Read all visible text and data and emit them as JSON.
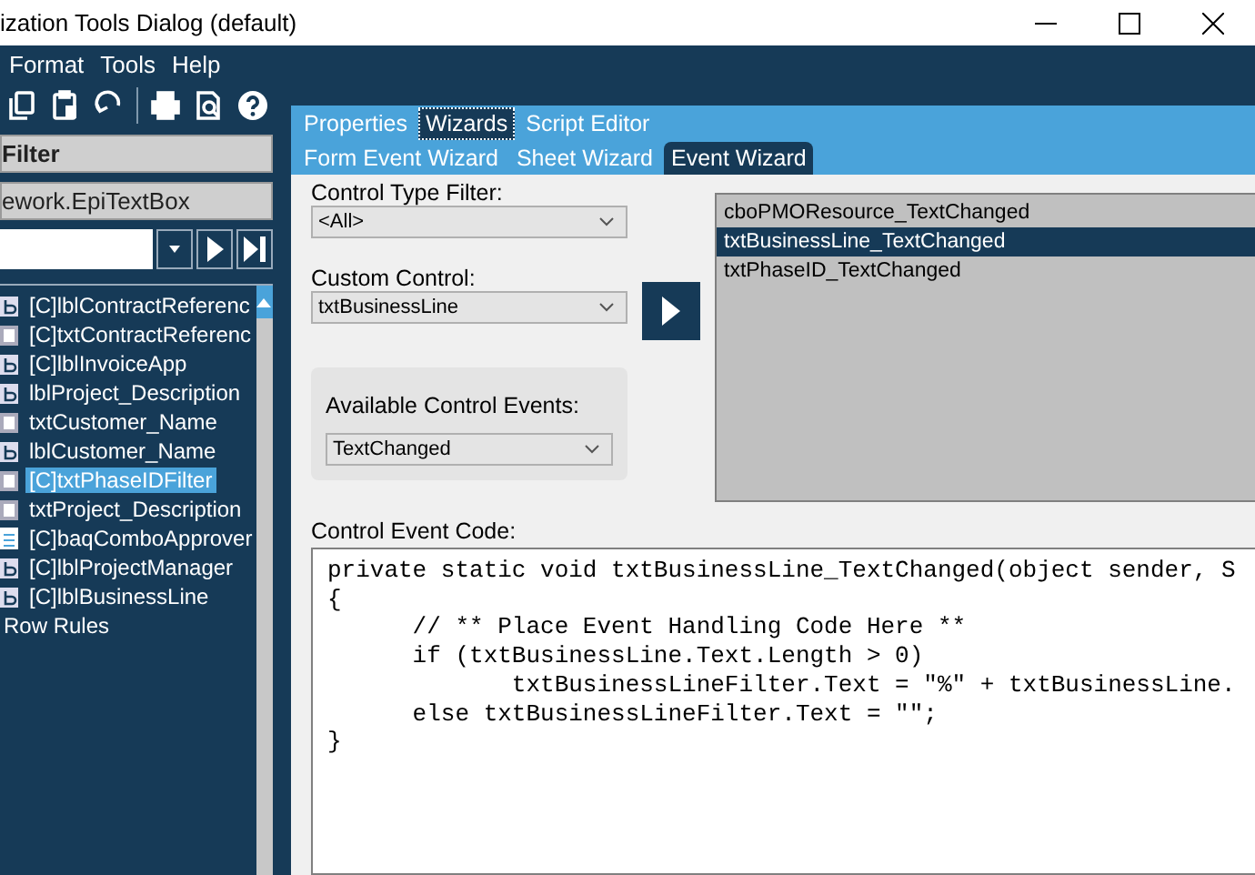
{
  "window": {
    "title": "ization Tools Dialog (default)"
  },
  "menu": [
    "Format",
    "Tools",
    "Help"
  ],
  "left_panel": {
    "header": "Filter",
    "type_field": "ework.EpiTextBox",
    "tree": [
      {
        "label": "[C]lblContractReferenc",
        "kind": "label",
        "selected": false
      },
      {
        "label": "[C]txtContractReferenc",
        "kind": "textbox",
        "selected": false
      },
      {
        "label": "[C]lblInvoiceApp",
        "kind": "label",
        "selected": false
      },
      {
        "label": "lblProject_Description",
        "kind": "label",
        "selected": false
      },
      {
        "label": "txtCustomer_Name",
        "kind": "textbox",
        "selected": false
      },
      {
        "label": "lblCustomer_Name",
        "kind": "label",
        "selected": false
      },
      {
        "label": "[C]txtPhaseIDFilter",
        "kind": "textbox",
        "selected": true
      },
      {
        "label": "txtProject_Description",
        "kind": "textbox",
        "selected": false
      },
      {
        "label": "[C]baqComboApprover",
        "kind": "combo",
        "selected": false
      },
      {
        "label": "[C]lblProjectManager",
        "kind": "label",
        "selected": false
      },
      {
        "label": "[C]lblBusinessLine",
        "kind": "label",
        "selected": false
      },
      {
        "label": "Row Rules",
        "kind": "folder",
        "selected": false
      }
    ]
  },
  "tabs": [
    {
      "label": "Properties",
      "selected": false
    },
    {
      "label": "Wizards",
      "selected": true
    },
    {
      "label": "Script Editor",
      "selected": false
    }
  ],
  "subtabs": [
    {
      "label": "Form Event Wizard",
      "selected": false
    },
    {
      "label": "Sheet Wizard",
      "selected": false
    },
    {
      "label": "Event Wizard",
      "selected": true
    }
  ],
  "control_type_filter": {
    "label": "Control Type Filter:",
    "value": "<All>"
  },
  "custom_control": {
    "label": "Custom Control:",
    "value": "txtBusinessLine"
  },
  "available_events": {
    "label": "Available Control Events:",
    "value": "TextChanged"
  },
  "event_list": [
    {
      "label": "cboPMOResource_TextChanged",
      "selected": false
    },
    {
      "label": "txtBusinessLine_TextChanged",
      "selected": true
    },
    {
      "label": "txtPhaseID_TextChanged",
      "selected": false
    }
  ],
  "code": {
    "label": "Control Event Code:",
    "lines": [
      "private static void txtBusinessLine_TextChanged(object sender, S",
      "{",
      "      // ** Place Event Handling Code Here **",
      "      if (txtBusinessLine.Text.Length > 0)",
      "             txtBusinessLineFilter.Text = \"%\" + txtBusinessLine.",
      "      else txtBusinessLineFilter.Text = \"\";",
      "}"
    ]
  }
}
